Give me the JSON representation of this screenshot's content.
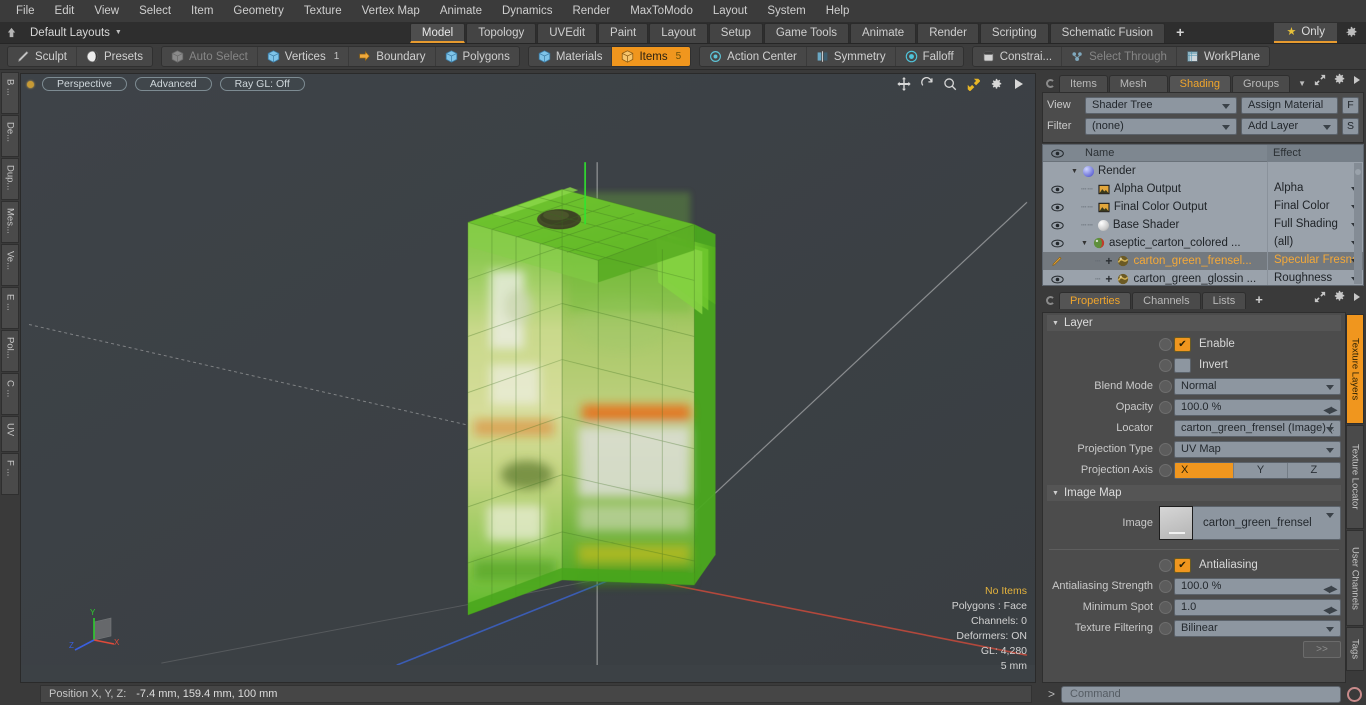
{
  "menu": {
    "items": [
      "File",
      "Edit",
      "View",
      "Select",
      "Item",
      "Geometry",
      "Texture",
      "Vertex Map",
      "Animate",
      "Dynamics",
      "Render",
      "MaxToModo",
      "Layout",
      "System",
      "Help"
    ]
  },
  "layoutbar": {
    "home_icon": "home-icon",
    "default_layouts": "Default Layouts",
    "tabs": [
      "Model",
      "Topology",
      "UVEdit",
      "Paint",
      "Layout",
      "Setup",
      "Game Tools",
      "Animate",
      "Render",
      "Scripting",
      "Schematic Fusion"
    ],
    "active_tab": "Model",
    "add_tab": "+",
    "only_label": "Only",
    "star_icon": "star-icon",
    "gear_icon": "gear-icon"
  },
  "modebar": {
    "group1": [
      {
        "label": "Sculpt",
        "icon": "pencil-icon",
        "state": "normal"
      },
      {
        "label": "Presets",
        "icon": "sphere-icon",
        "state": "normal"
      }
    ],
    "group2": [
      {
        "label": "Auto Select",
        "icon": "cube-gray-icon",
        "state": "dim"
      },
      {
        "label": "Vertices",
        "icon": "cube-vertex-icon",
        "state": "normal",
        "num": "1"
      },
      {
        "label": "Boundary",
        "icon": "boundary-icon",
        "state": "normal"
      },
      {
        "label": "Polygons",
        "icon": "cube-poly-icon",
        "state": "normal"
      }
    ],
    "group3": [
      {
        "label": "Materials",
        "icon": "cube-material-icon",
        "state": "normal"
      },
      {
        "label": "Items",
        "icon": "cube-items-icon",
        "state": "selected",
        "num": "5"
      }
    ],
    "group4": [
      {
        "label": "Action Center",
        "icon": "target-icon",
        "state": "normal"
      },
      {
        "label": "Symmetry",
        "icon": "symmetry-icon",
        "state": "normal"
      },
      {
        "label": "Falloff",
        "icon": "falloff-icon",
        "state": "normal"
      }
    ],
    "group5": [
      {
        "label": "Constrai...",
        "icon": "constrain-icon",
        "state": "normal"
      },
      {
        "label": "Select Through",
        "icon": "select-through-icon",
        "state": "dim"
      },
      {
        "label": "WorkPlane",
        "icon": "workplane-icon",
        "state": "normal"
      }
    ]
  },
  "left_vtabs": [
    "B ...",
    "De...",
    "Dup...",
    "Mes...",
    "Ve...",
    "E ...",
    "Pol...",
    "C ...",
    "UV",
    "F ..."
  ],
  "viewport": {
    "dot": "active-indicator",
    "buttons": [
      "Perspective",
      "Advanced",
      "Ray GL: Off"
    ],
    "icons": [
      "move-icon",
      "rotate-icon",
      "zoom-icon",
      "fit-icon",
      "gear-icon",
      "play-icon"
    ],
    "stats": {
      "no_items": "No Items",
      "polygons": "Polygons : Face",
      "channels": "Channels: 0",
      "deformers": "Deformers: ON",
      "gl": "GL: 4,280",
      "scale": "5 mm"
    },
    "axis_labels": {
      "x": "X",
      "y": "Y",
      "z": "Z"
    }
  },
  "statusbar": {
    "label": "Position X, Y, Z:",
    "value": "-7.4 mm,  159.4 mm,  100 mm"
  },
  "right_panel": {
    "tabs": [
      "Items",
      "Mesh ...",
      "Shading",
      "Groups"
    ],
    "active_tab": "Shading",
    "shading": {
      "view_label": "View",
      "view_value": "Shader Tree",
      "assign_material": "Assign Material",
      "f_button": "F",
      "filter_label": "Filter",
      "filter_value": "(none)",
      "add_layer": "Add Layer",
      "s_button": "S",
      "columns": {
        "name": "Name",
        "effect": "Effect"
      },
      "rows": [
        {
          "name": "Render",
          "effect": "",
          "depth": 0,
          "icon": "sphere-blue-icon",
          "twist": true,
          "eye": false,
          "selected": false
        },
        {
          "name": "Alpha Output",
          "effect": "Alpha",
          "depth": 1,
          "icon": "image-output-icon",
          "eye": true,
          "selected": false
        },
        {
          "name": "Final Color Output",
          "effect": "Final Color",
          "depth": 1,
          "icon": "image-output-icon",
          "eye": true,
          "selected": false
        },
        {
          "name": "Base Shader",
          "effect": "Full Shading",
          "depth": 1,
          "icon": "sphere-white-icon",
          "eye": true,
          "selected": false
        },
        {
          "name": "aseptic_carton_colored  ...",
          "effect": "(all)",
          "depth": 1,
          "icon": "material-icon",
          "twist": true,
          "eye": true,
          "selected": false
        },
        {
          "name": "carton_green_frensel...",
          "effect": "Specular Fresnel",
          "depth": 2,
          "icon": "texture-icon",
          "plus": true,
          "eye": false,
          "brush": true,
          "selected": true
        },
        {
          "name": "carton_green_glossin ...",
          "effect": "Roughness",
          "depth": 2,
          "icon": "texture-icon",
          "plus": true,
          "eye": true,
          "selected": false
        }
      ]
    },
    "properties": {
      "tabs": [
        "Properties",
        "Channels",
        "Lists"
      ],
      "active_tab": "Properties",
      "add_tab": "+",
      "sections": {
        "layer": "Layer",
        "image_map": "Image Map"
      },
      "enable_label": "Enable",
      "enable_checked": true,
      "invert_label": "Invert",
      "invert_checked": false,
      "blend_mode_label": "Blend Mode",
      "blend_mode_value": "Normal",
      "opacity_label": "Opacity",
      "opacity_value": "100.0 %",
      "locator_label": "Locator",
      "locator_value": "carton_green_frensel (Image) (...",
      "projection_type_label": "Projection Type",
      "projection_type_value": "UV Map",
      "projection_axis_label": "Projection Axis",
      "projection_axis_options": [
        "X",
        "Y",
        "Z"
      ],
      "projection_axis_selected": "X",
      "image_label": "Image",
      "image_value": "carton_green_frensel",
      "antialiasing_label": "Antialiasing",
      "antialiasing_checked": true,
      "aa_strength_label": "Antialiasing Strength",
      "aa_strength_value": "100.0 %",
      "min_spot_label": "Minimum Spot",
      "min_spot_value": "1.0",
      "texture_filtering_label": "Texture Filtering",
      "texture_filtering_value": "Bilinear",
      "forward_button": ">>"
    },
    "vtabs": [
      "Texture Layers",
      "Texture Locator",
      "User Channels",
      "Tags"
    ],
    "vtab_active": "Texture Layers"
  },
  "command": {
    "prompt": ">",
    "placeholder": "Command",
    "record_icon": "record-icon"
  },
  "colors": {
    "accent": "#f0961e",
    "panel": "#4c4c4c",
    "field": "#8d96a0",
    "viewport_bg": "#3c4145",
    "model_green": "#6cc531"
  }
}
